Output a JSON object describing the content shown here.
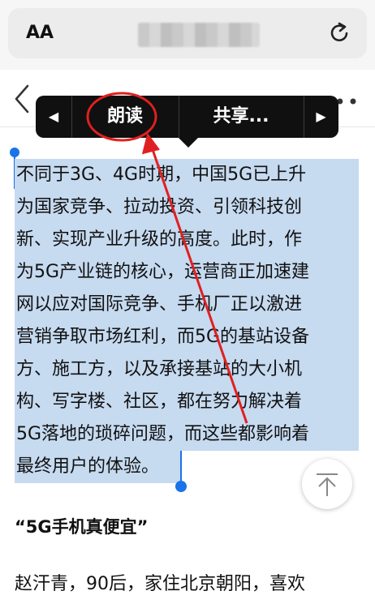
{
  "browser": {
    "text_size_label": "AA",
    "url_masked": true
  },
  "callout": {
    "prev_arrow": "◀",
    "read_aloud": "朗读",
    "share": "共享...",
    "next_arrow": "▶"
  },
  "article": {
    "selected_lines": [
      "不同于3G、4G时期，中国5G已上升",
      "为国家竞争、拉动投资、引领科技创",
      "新、实现产业升级的高度。此时，作",
      "为5G产业链的核心，运营商正加速建",
      "网以应对国际竞争、手机厂正以激进",
      "营销争取市场红利，而5G的基站设备",
      "方、施工方，以及承接基站的大小机",
      "构、写字楼、社区，都在努力解决着",
      "5G落地的琐碎问题，而这些都影响着",
      "最终用户的体验。"
    ],
    "subtitle": "“5G手机真便宜”",
    "next_paragraph": "赵汗青，90后，家住北京朝阳，喜欢"
  },
  "colors": {
    "selection": "#c6daf0",
    "handle": "#1a73e8",
    "annotation": "#e02020",
    "callout_bg": "#101010"
  },
  "icons": {
    "reload": "reload-icon",
    "back": "chevron-left-icon",
    "more": "more-icon",
    "scroll_top": "arrow-up-icon"
  }
}
